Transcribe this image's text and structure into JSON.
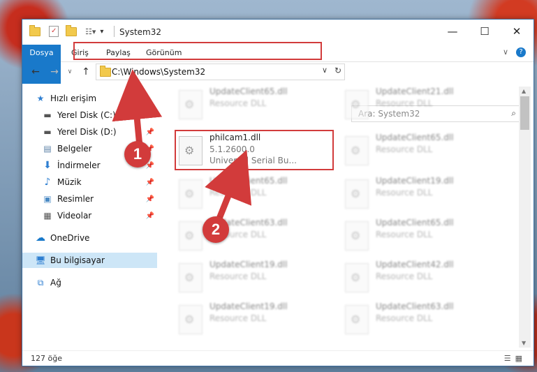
{
  "window": {
    "title": "System32",
    "buttons": {
      "minimize": "—",
      "maximize": "☐",
      "close": "✕"
    }
  },
  "ribbon": {
    "tabs": [
      "Dosya",
      "Giriş",
      "Paylaş",
      "Görünüm"
    ]
  },
  "address": {
    "path": "C:\\Windows\\System32",
    "search_placeholder": "Ara: System32"
  },
  "nav": {
    "items": [
      {
        "label": "Hızlı erişim",
        "icon": "star-icon"
      },
      {
        "label": "Yerel Disk (C:)",
        "icon": "drive-icon",
        "pinned": true
      },
      {
        "label": "Yerel Disk (D:)",
        "icon": "drive-icon",
        "pinned": true
      },
      {
        "label": "Belgeler",
        "icon": "document-icon",
        "pinned": true
      },
      {
        "label": "İndirmeler",
        "icon": "download-icon",
        "pinned": true
      },
      {
        "label": "Müzik",
        "icon": "music-icon",
        "pinned": true
      },
      {
        "label": "Resimler",
        "icon": "pictures-icon",
        "pinned": true
      },
      {
        "label": "Videolar",
        "icon": "video-icon",
        "pinned": true
      },
      {
        "label": "OneDrive",
        "icon": "cloud-icon"
      },
      {
        "label": "Bu bilgisayar",
        "icon": "computer-icon",
        "selected": true
      },
      {
        "label": "Ağ",
        "icon": "network-icon"
      }
    ]
  },
  "files": {
    "left": [
      {
        "name": "UpdateClient65.dll",
        "type": "Resource DLL"
      },
      {
        "name": "philcam1.dll",
        "version": "5.1.2600.0",
        "description": "Universal Serial Bu..."
      },
      {
        "name": "UpdateClient65.dll",
        "type": "Resource DLL"
      },
      {
        "name": "UpdateClient63.dll",
        "type": "Resource DLL"
      },
      {
        "name": "UpdateClient19.dll",
        "type": "Resource DLL"
      },
      {
        "name": "UpdateClient19.dll",
        "type": "Resource DLL"
      }
    ],
    "right": [
      {
        "name": "UpdateClient21.dll",
        "type": "Resource DLL"
      },
      {
        "name": "UpdateClient65.dll",
        "type": "Resource DLL"
      },
      {
        "name": "UpdateClient19.dll",
        "type": "Resource DLL"
      },
      {
        "name": "UpdateClient65.dll",
        "type": "Resource DLL"
      },
      {
        "name": "UpdateClient42.dll",
        "type": "Resource DLL"
      },
      {
        "name": "UpdateClient63.dll",
        "type": "Resource DLL"
      }
    ]
  },
  "status": {
    "count": "127 öğe"
  },
  "callouts": {
    "one": "1",
    "two": "2"
  },
  "colors": {
    "accent": "#1979ca",
    "highlight": "#d23b3b",
    "selected": "#cde6f7"
  }
}
